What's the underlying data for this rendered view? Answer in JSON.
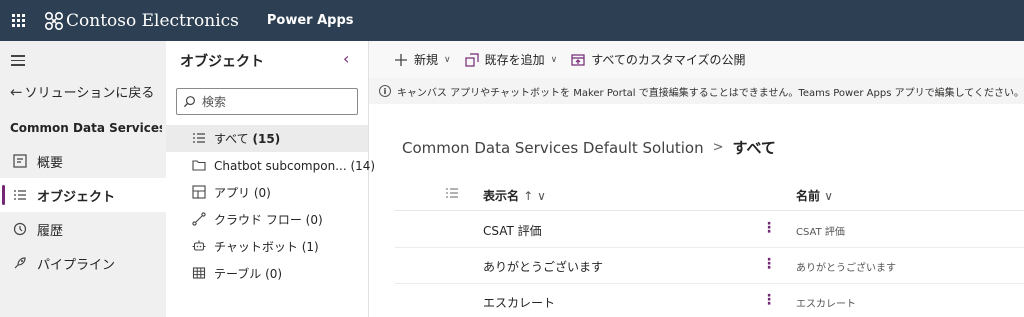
{
  "topbar": {
    "brand": "Contoso Electronics",
    "product": "Power Apps"
  },
  "leftnav": {
    "back_label": "ソリューションに戻る",
    "solution_name": "Common Data Services ...",
    "items": [
      {
        "label": "概要",
        "icon": "overview-icon"
      },
      {
        "label": "オブジェクト",
        "icon": "objects-icon",
        "active": true
      },
      {
        "label": "履歴",
        "icon": "history-icon"
      },
      {
        "label": "パイプライン",
        "icon": "pipeline-icon"
      }
    ]
  },
  "objects_panel": {
    "title": "オブジェクト",
    "search_placeholder": "検索",
    "items": [
      {
        "label": "すべて",
        "count": "(15)",
        "icon": "list-icon",
        "active": true
      },
      {
        "label": "Chatbot subcompon...",
        "count": "(14)",
        "icon": "folder-icon"
      },
      {
        "label": "アプリ",
        "count": "(0)",
        "icon": "app-icon"
      },
      {
        "label": "クラウド フロー",
        "count": "(0)",
        "icon": "flow-icon"
      },
      {
        "label": "チャットボット",
        "count": "(1)",
        "icon": "chatbot-icon"
      },
      {
        "label": "テーブル",
        "count": "(0)",
        "icon": "table-icon"
      }
    ]
  },
  "commandbar": {
    "new_label": "新規",
    "add_existing_label": "既存を追加",
    "publish_label": "すべてのカスタマイズの公開"
  },
  "infobar": {
    "message": "キャンバス アプリやチャットボットを Maker Portal で直接編集することはできません。Teams Power Apps アプリで編集してください。"
  },
  "breadcrumb": {
    "solution": "Common Data Services Default Solution",
    "separator": ">",
    "current": "すべて"
  },
  "grid": {
    "col_display_name": "表示名",
    "col_display_name_suffix": "↑ ∨",
    "col_name": "名前",
    "col_name_suffix": "∨",
    "rows": [
      {
        "display_name": "CSAT 評価",
        "name": "CSAT 評価"
      },
      {
        "display_name": "ありがとうございます",
        "name": "ありがとうございます"
      },
      {
        "display_name": "エスカレート",
        "name": "エスカレート"
      }
    ]
  },
  "colors": {
    "topbar": "#2d3f52",
    "accent": "#742774"
  }
}
